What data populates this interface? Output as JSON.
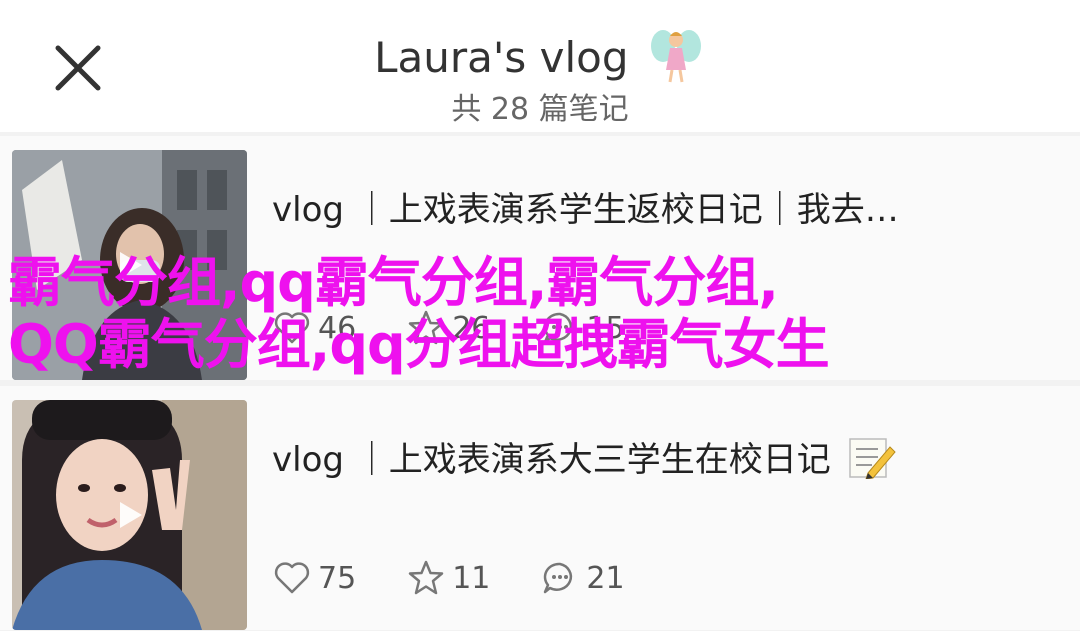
{
  "header": {
    "title": "Laura's vlog",
    "subtitle": "共 28 篇笔记",
    "close_icon": "close-icon",
    "title_emoji": "fairy-emoji"
  },
  "notes": [
    {
      "title": "vlog ｜上戏表演系学生返校日记｜我去…",
      "likes": "46",
      "stars": "26",
      "comments": "15"
    },
    {
      "title": "vlog ｜上戏表演系大三学生在校日记",
      "title_emoji": "pencil-memo-emoji",
      "likes": "75",
      "stars": "11",
      "comments": "21"
    }
  ],
  "overlay": {
    "line1": "霸气分组,qq霸气分组,霸气分组,",
    "line2": "QQ霸气分组,qq分组超拽霸气女生",
    "color": "#ee11ee"
  }
}
